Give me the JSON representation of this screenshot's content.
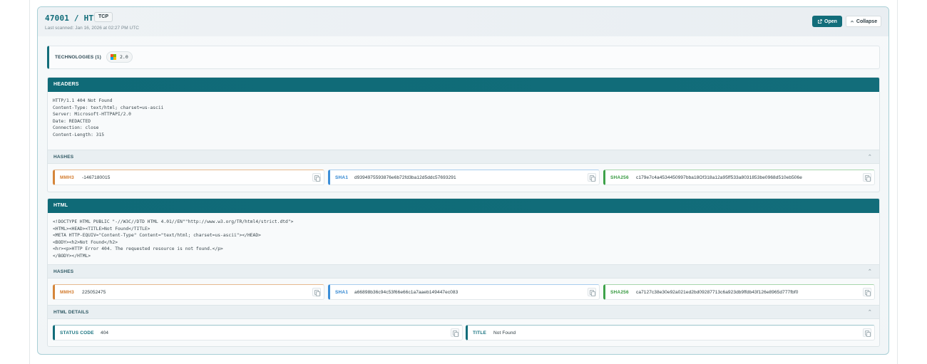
{
  "port": {
    "title": "47001 / HTTP",
    "protocol": "TCP",
    "last_scanned": "Last scanned: Jan 16, 2026 at 02:27 PM UTC"
  },
  "actions": {
    "open_label": "Open",
    "collapse_label": "Collapse"
  },
  "technologies": {
    "label": "TECHNOLOGIES (1)",
    "items": [
      {
        "icon": "microsoft-logo-icon",
        "version": "2.0"
      }
    ]
  },
  "headers": {
    "title": "HEADERS",
    "raw": "HTTP/1.1 404 Not Found\nContent-Type: text/html; charset=us-ascii\nServer: Microsoft-HTTPAPI/2.0\nDate: REDACTED\nConnection: close\nContent-Length: 315",
    "hashes_title": "HASHES",
    "hashes": [
      {
        "label": "MMH3",
        "value": "-1467180015"
      },
      {
        "label": "SHA1",
        "value": "d9394975593876e6b72fd3ba12d5ddc57693291"
      },
      {
        "label": "SHA256",
        "value": "c179e7c4a4534450997bba18Of318a12a95ff533a8031853be0968d510eb506e"
      }
    ]
  },
  "html": {
    "title": "HTML",
    "raw": "<!DOCTYPE HTML PUBLIC \"-//W3C//DTD HTML 4.01//EN\"\"http://www.w3.org/TR/html4/strict.dtd\">\n<HTML><HEAD><TITLE>Not Found</TITLE>\n<META HTTP-EQUIV=\"Content-Type\" Content=\"text/html; charset=us-ascii\"></HEAD>\n<BODY><h2>Not Found</h2>\n<hr><p>HTTP Error 404. The requested resource is not found.</p>\n</BODY></HTML>",
    "hashes_title": "HASHES",
    "hashes": [
      {
        "label": "MMH3",
        "value": "225052475"
      },
      {
        "label": "SHA1",
        "value": "a66898b36c94c53f66e66c1a7aaeb149447ec083"
      },
      {
        "label": "SHA256",
        "value": "ca7127c38e30e92a021ed2bd09287713c6a923db9ffdb43f126e8965d777fbf0"
      }
    ],
    "details_title": "HTML DETAILS",
    "details": [
      {
        "label": "STATUS CODE",
        "value": "404"
      },
      {
        "label": "TITLE",
        "value": "Not Found"
      }
    ]
  },
  "colors": {
    "accent": "#126d7a",
    "mmh3": "#d5853a",
    "sha1": "#3b8ed8",
    "sha256": "#3ea24a"
  }
}
